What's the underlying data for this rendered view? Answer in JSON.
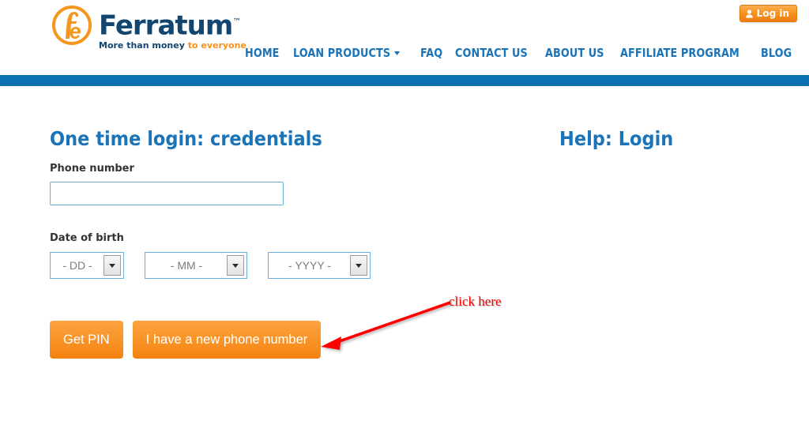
{
  "header": {
    "logo": {
      "monogram": "fe",
      "brand": "Ferratum",
      "trademark": "™",
      "tagline_primary": "More than money",
      "tagline_secondary": "to everyone"
    },
    "login_button": {
      "label": "Log in",
      "icon": "user-icon"
    },
    "nav": [
      {
        "label": "HOME",
        "has_caret": false
      },
      {
        "label": "LOAN PRODUCTS",
        "has_caret": true
      },
      {
        "label": "FAQ",
        "has_caret": false
      },
      {
        "label": "CONTACT US",
        "has_caret": false
      },
      {
        "label": "ABOUT US",
        "has_caret": false
      },
      {
        "label": "AFFILIATE PROGRAM",
        "has_caret": false
      },
      {
        "label": "BLOG",
        "has_caret": false
      }
    ]
  },
  "main": {
    "left": {
      "title": "One time login: credentials",
      "phone_label": "Phone number",
      "phone_value": "",
      "phone_placeholder": "",
      "dob_label": "Date of birth",
      "dob": {
        "day": "- DD -",
        "month": "- MM -",
        "year": "- YYYY -"
      },
      "buttons": {
        "get_pin": "Get PIN",
        "new_phone": "I have a new phone number"
      }
    },
    "right": {
      "title": "Help: Login"
    }
  },
  "annotation": {
    "text": "click here",
    "color": "#fe0000"
  },
  "colors": {
    "brand_blue": "#12456f",
    "nav_blue": "#1b73b8",
    "bar_blue": "#0a70b0",
    "orange": "#f7921e",
    "button_orange": "#f9962b",
    "input_border": "#6aaed8"
  }
}
